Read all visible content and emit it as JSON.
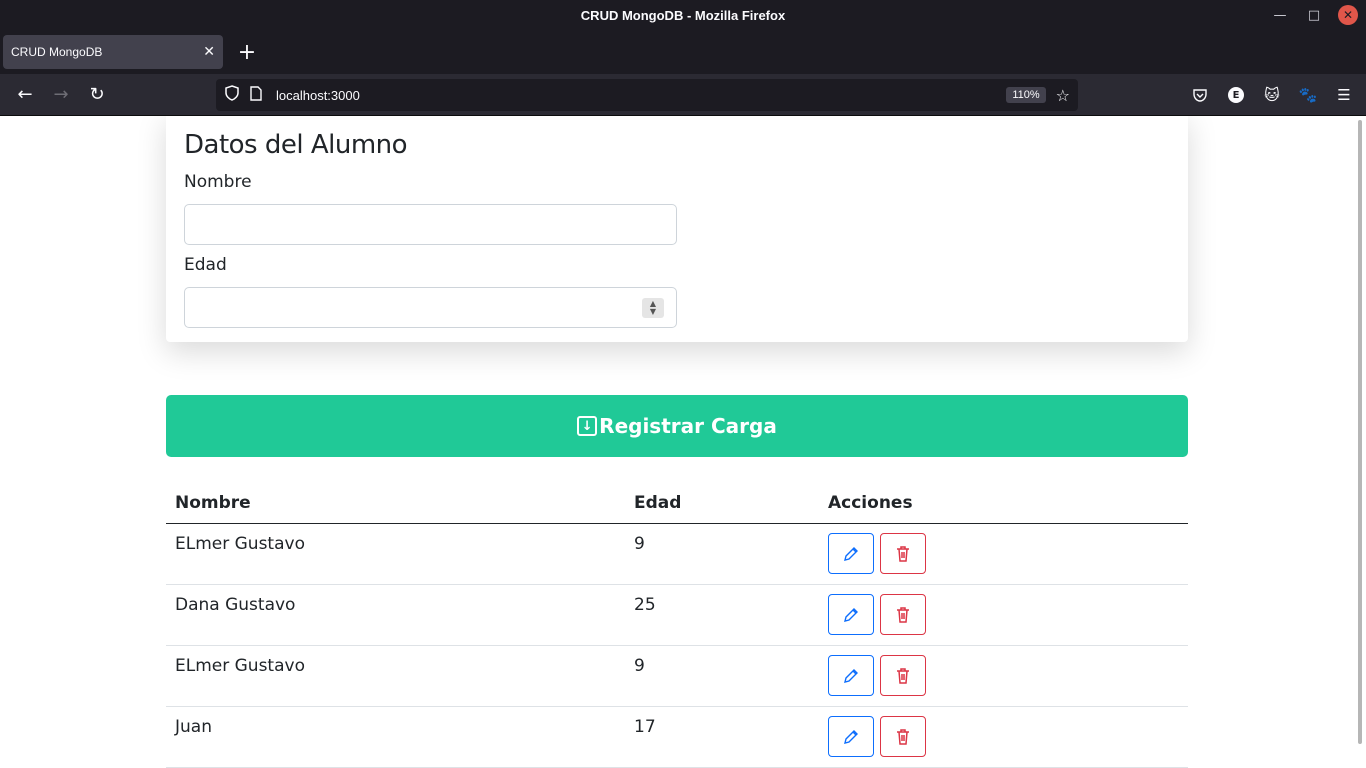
{
  "window": {
    "title": "CRUD MongoDB - Mozilla Firefox"
  },
  "tabs": [
    {
      "label": "CRUD MongoDB"
    }
  ],
  "navbar": {
    "url": "localhost:3000",
    "zoom": "110%"
  },
  "form": {
    "heading": "Datos del Alumno",
    "nombre_label": "Nombre",
    "nombre_value": "",
    "edad_label": "Edad",
    "edad_value": ""
  },
  "register_button": {
    "label": "Registrar Carga"
  },
  "table": {
    "headers": [
      "Nombre",
      "Edad",
      "Acciones"
    ],
    "rows": [
      {
        "nombre": "ELmer Gustavo",
        "edad": "9"
      },
      {
        "nombre": "Dana Gustavo",
        "edad": "25"
      },
      {
        "nombre": "ELmer Gustavo",
        "edad": "9"
      },
      {
        "nombre": "Juan",
        "edad": "17"
      }
    ]
  },
  "icons": {
    "edit": "pencil-icon",
    "delete": "trash-icon",
    "register": "download-box-icon"
  },
  "colors": {
    "register": "#20c997",
    "edit": "#0d6efd",
    "delete": "#dc3545"
  }
}
